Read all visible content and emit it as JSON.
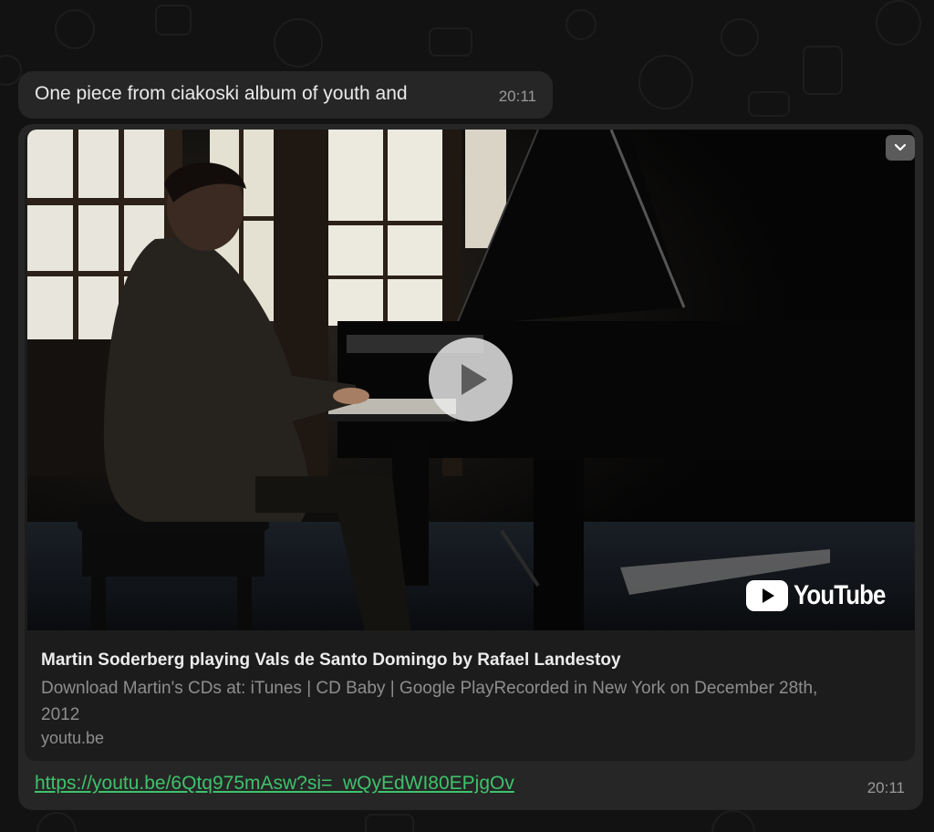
{
  "messages": {
    "first": {
      "text": "One piece from ciakoski album of youth and",
      "time": "20:11"
    },
    "second": {
      "preview": {
        "title": "Martin Soderberg playing Vals de Santo Domingo by Rafael Landestoy",
        "description": "Download Martin's CDs at: iTunes | CD Baby | Google PlayRecorded in New York on December 28th, 2012",
        "domain": "youtu.be",
        "brand": "YouTube",
        "thumbnail_icon": "youtube-logo-icon",
        "play_icon": "play-icon",
        "menu_icon": "chevron-down-icon"
      },
      "link": "https://youtu.be/6Qtq975mAsw?si=_wQyEdWI80EPjgOv",
      "time": "20:11"
    }
  },
  "colors": {
    "link": "#3ec26b",
    "bubble": "#262626",
    "card": "#1c1c1c",
    "background": "#121212"
  }
}
